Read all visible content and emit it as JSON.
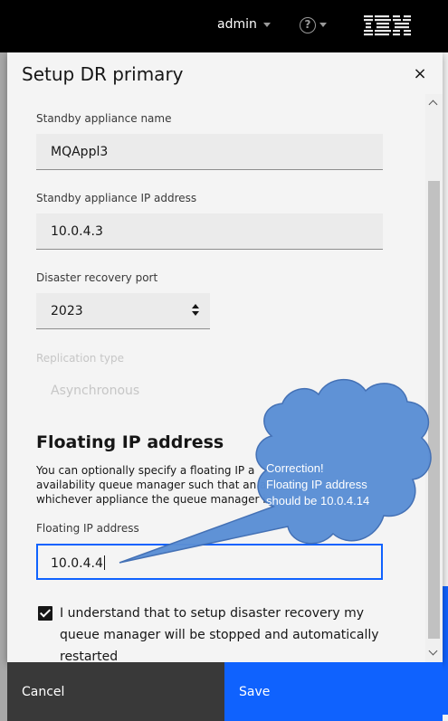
{
  "topbar": {
    "user": "admin",
    "help_symbol": "?",
    "logo": "IBM"
  },
  "modal": {
    "title": "Setup DR primary",
    "close_symbol": "×",
    "fields": {
      "standby_name": {
        "label": "Standby appliance name",
        "value": "MQAppl3"
      },
      "standby_ip": {
        "label": "Standby appliance IP address",
        "value": "10.0.4.3"
      },
      "dr_port": {
        "label": "Disaster recovery port",
        "value": "2023"
      },
      "replication": {
        "label": "Replication type",
        "value": "Asynchronous"
      }
    },
    "floating": {
      "title": "Floating IP address",
      "desc_lines": [
        "You can optionally specify a floating IP a",
        "availability queue manager such that an a",
        "whichever appliance the queue manager i"
      ],
      "label": "Floating IP address",
      "value": "10.0.4.4"
    },
    "acknowledge": {
      "checked": true,
      "text": "I understand that to setup disaster recovery my queue manager will be stopped and automatically restarted"
    }
  },
  "footer": {
    "cancel_label": "Cancel",
    "save_label": "Save"
  },
  "callout": {
    "lines": [
      "Correction!",
      "Floating IP address",
      "should be 10.0.4.14"
    ],
    "fill_color": "#5b8fd6",
    "stroke_color": "#3f6db3"
  },
  "colors": {
    "primary": "#0f62fe",
    "topbar": "#000000",
    "cancel": "#393939"
  }
}
